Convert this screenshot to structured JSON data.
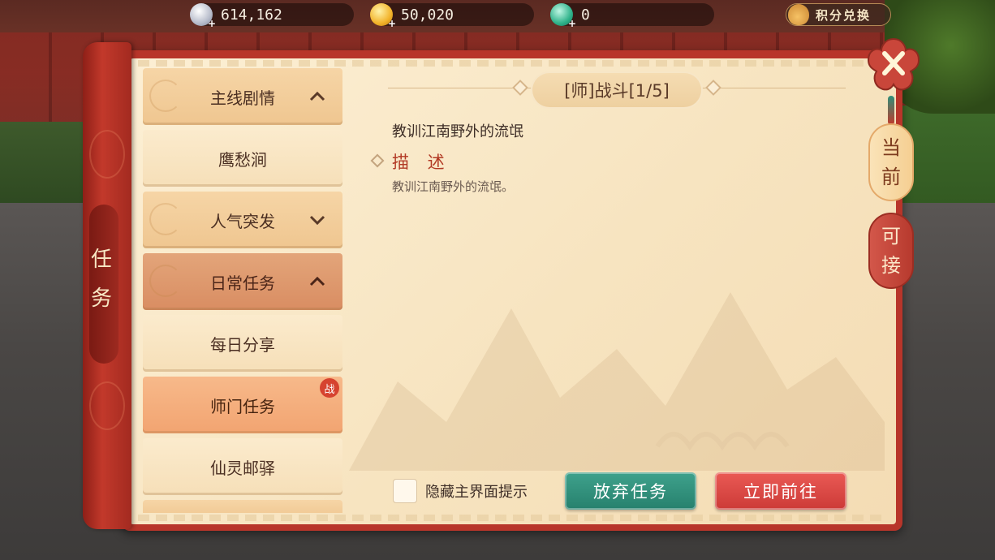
{
  "currencies": {
    "silver": {
      "value": "614,162",
      "icon": "silver-coin-icon"
    },
    "gold": {
      "value": "50,020",
      "icon": "gold-coin-icon"
    },
    "jade": {
      "value": "0",
      "icon": "jade-icon"
    }
  },
  "points_exchange": {
    "label": "积分兑换",
    "icon": "money-bag-icon"
  },
  "panel": {
    "title": "任务"
  },
  "task_list": [
    {
      "label": "主线剧情",
      "type": "category",
      "expanded": true
    },
    {
      "label": "鹰愁涧",
      "type": "task"
    },
    {
      "label": "人气突发",
      "type": "category",
      "expanded": false
    },
    {
      "label": "日常任务",
      "type": "category",
      "expanded": true
    },
    {
      "label": "每日分享",
      "type": "task"
    },
    {
      "label": "师门任务",
      "type": "task",
      "selected": true,
      "badge": "战"
    },
    {
      "label": "仙灵邮驿",
      "type": "task"
    }
  ],
  "detail": {
    "title": "[师]战斗[1/5]",
    "objective": "教训江南野外的流氓",
    "description_heading": "描 述",
    "description": "教训江南野外的流氓。"
  },
  "hide_hint": {
    "label": "隐藏主界面提示",
    "checked": false
  },
  "buttons": {
    "abandon": "放弃任务",
    "goto": "立即前往"
  },
  "side_tabs": [
    {
      "label": "当前",
      "active": true
    },
    {
      "label": "可接",
      "active": false
    }
  ],
  "colors": {
    "frame_red": "#b8352a",
    "parchment": "#fcefd4",
    "abandon_green": "#26806d",
    "goto_red": "#cc3a37",
    "selected_orange": "#f2a471"
  }
}
